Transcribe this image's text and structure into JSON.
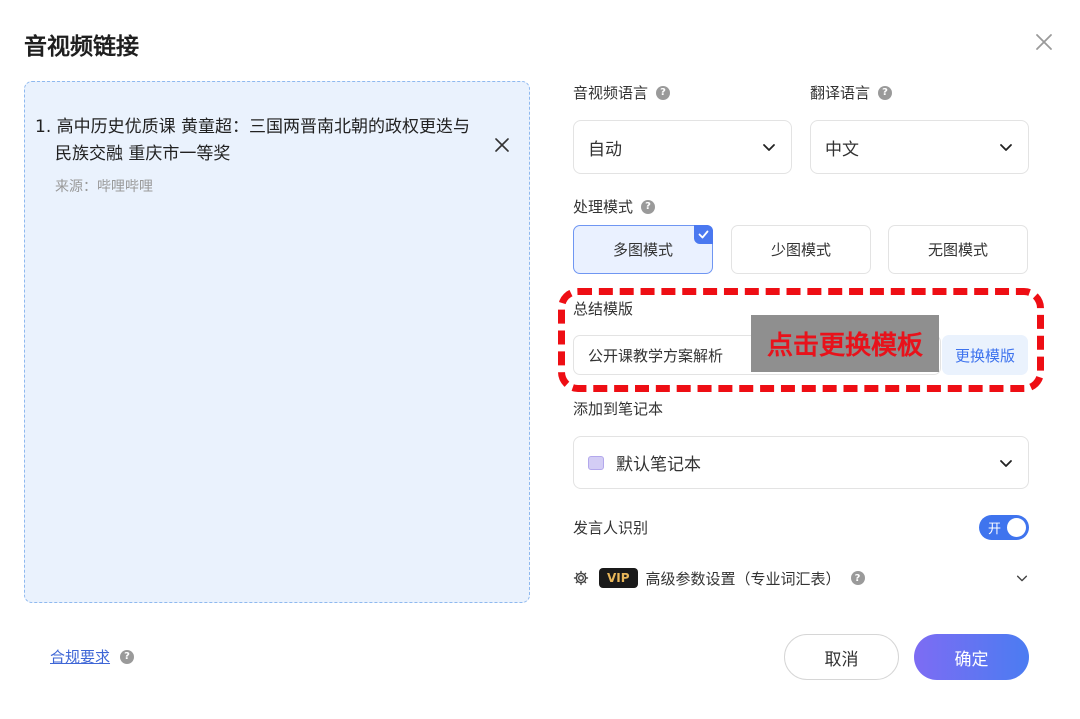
{
  "dialog": {
    "title": "音视频链接"
  },
  "video_list": {
    "items": [
      {
        "index": "1.",
        "title": "高中历史优质课 黄童超：三国两晋南北朝的政权更迭与民族交融 重庆市一等奖",
        "source": "来源：哔哩哔哩"
      }
    ]
  },
  "settings": {
    "audio_language": {
      "label": "音视频语言",
      "value": "自动"
    },
    "translate_language": {
      "label": "翻译语言",
      "value": "中文"
    },
    "processing_mode": {
      "label": "处理模式",
      "options": [
        "多图模式",
        "少图模式",
        "无图模式"
      ],
      "selected": "多图模式"
    },
    "summary_template": {
      "label": "总结模版",
      "value": "公开课教学方案解析",
      "change_label": "更换模版",
      "callout": "点击更换模板"
    },
    "notebook": {
      "label": "添加到笔记本",
      "value": "默认笔记本"
    },
    "speaker_recognition": {
      "label": "发言人识别",
      "toggle_text": "开",
      "enabled": true
    },
    "advanced": {
      "vip_badge": "VIP",
      "label": "高级参数设置（专业词汇表）"
    }
  },
  "footer": {
    "compliance_link": "合规要求",
    "cancel_label": "取消",
    "confirm_label": "确定"
  },
  "colors": {
    "accent": "#3f74ee",
    "highlight": "#ee0e14",
    "drop_zone_bg": "#eaf2fd"
  }
}
